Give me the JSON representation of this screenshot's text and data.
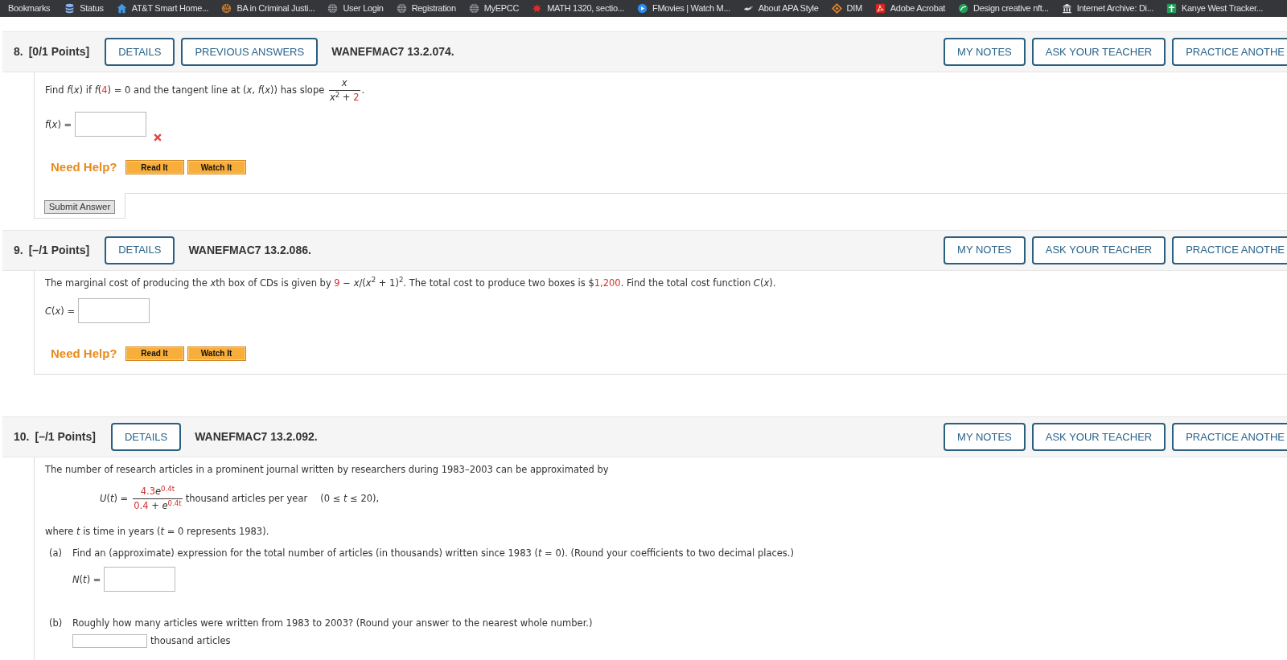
{
  "bookmarks_bar": {
    "label": "Bookmarks",
    "items": [
      {
        "label": "Status"
      },
      {
        "label": "AT&T Smart Home..."
      },
      {
        "label": "BA in Criminal Justi..."
      },
      {
        "label": "User Login"
      },
      {
        "label": "Registration"
      },
      {
        "label": "MyEPCC"
      },
      {
        "label": "MATH 1320, sectio..."
      },
      {
        "label": "FMovies | Watch M..."
      },
      {
        "label": "About APA Style"
      },
      {
        "label": "DIM"
      },
      {
        "label": "Adobe Acrobat"
      },
      {
        "label": "Design creative nft..."
      },
      {
        "label": "Internet Archive: Di..."
      },
      {
        "label": "Kanye West Tracker..."
      }
    ]
  },
  "questions": [
    {
      "number": "8.",
      "points": "[0/1 Points]",
      "header_buttons": [
        "DETAILS",
        "PREVIOUS ANSWERS"
      ],
      "code": "WANEFMAC7 13.2.074.",
      "side_buttons": [
        "MY NOTES",
        "ASK YOUR TEACHER",
        "PRACTICE ANOTHE"
      ],
      "blocks": [
        {
          "kind": "paragraph",
          "segments": [
            {
              "kind": "plain",
              "text": "Find *f*(*x*) if *f*("
            },
            {
              "kind": "given",
              "text": "4"
            },
            {
              "kind": "plain",
              "text": ") = 0 and the tangent line at (*x*, *f*(*x*)) has slope "
            },
            {
              "kind": "fraction",
              "numerator": [
                {
                  "kind": "plain",
                  "text": "*x*"
                }
              ],
              "denominator": [
                {
                  "kind": "plain",
                  "text": "*x*$^{2}$ + "
                },
                {
                  "kind": "given",
                  "text": "2"
                }
              ]
            },
            {
              "kind": "plain",
              "text": "."
            }
          ]
        },
        {
          "kind": "answer",
          "label": "*f*(*x*) =",
          "correct": false
        }
      ],
      "need_help": {
        "label": "Need Help?",
        "buttons": [
          "Read It",
          "Watch It"
        ]
      },
      "submit_button": "Submit Answer"
    },
    {
      "number": "9.",
      "points": "[–/1 Points]",
      "header_buttons": [
        "DETAILS"
      ],
      "code": "WANEFMAC7 13.2.086.",
      "side_buttons": [
        "MY NOTES",
        "ASK YOUR TEACHER",
        "PRACTICE ANOTHE"
      ],
      "blocks": [
        {
          "kind": "paragraph",
          "segments": [
            {
              "kind": "plain",
              "text": "The marginal cost of producing the "
            },
            {
              "kind": "plain",
              "text": "*x*"
            },
            {
              "kind": "plain",
              "text": "th box of CDs is given by "
            },
            {
              "kind": "given",
              "text": "9"
            },
            {
              "kind": "plain",
              "text": " − *x*/(*x*$^{2}$ + 1)$^{2}$. The total cost to produce two boxes is $"
            },
            {
              "kind": "given",
              "text": "1,200"
            },
            {
              "kind": "plain",
              "text": ". Find the total cost function *C*(*x*)."
            }
          ]
        },
        {
          "kind": "answer",
          "label": "*C*(*x*) ="
        }
      ],
      "need_help": {
        "label": "Need Help?",
        "buttons": [
          "Read It",
          "Watch It"
        ]
      }
    },
    {
      "number": "10.",
      "points": "[–/1 Points]",
      "header_buttons": [
        "DETAILS"
      ],
      "code": "WANEFMAC7 13.2.092.",
      "side_buttons": [
        "MY NOTES",
        "ASK YOUR TEACHER",
        "PRACTICE ANOTHE"
      ],
      "blocks": [
        {
          "kind": "paragraph",
          "segments": [
            {
              "kind": "plain",
              "text": "The number of research articles in a prominent journal written by researchers during 1983–2003 can be approximated by"
            }
          ]
        },
        {
          "kind": "formula",
          "label": "*U*(*t*) =",
          "segments": [
            {
              "kind": "fraction",
              "numerator": [
                {
                  "kind": "given",
                  "text": "4.3"
                },
                {
                  "kind": "plain",
                  "text": "*e*"
                },
                {
                  "kind": "given",
                  "text": "$^{0.4t}$"
                }
              ],
              "denominator": [
                {
                  "kind": "given",
                  "text": "0.4"
                },
                {
                  "kind": "plain",
                  "text": " + *e*"
                },
                {
                  "kind": "given",
                  "text": "$^{0.4t}$"
                }
              ]
            }
          ],
          "unit": "thousand articles per year",
          "domain": "(0 ≤ *t* ≤ 20),"
        },
        {
          "kind": "paragraph",
          "segments": [
            {
              "kind": "plain",
              "text": "where *t* is time in years (*t* = 0 represents 1983)."
            }
          ]
        },
        {
          "kind": "part",
          "label": "(a)",
          "segments": [
            {
              "kind": "plain",
              "text": "Find an (approximate) expression for the total number of articles (in thousands) written since 1983 (*t* = 0). (Round your coefficients to two decimal places.)"
            }
          ],
          "children": [
            {
              "kind": "answer",
              "label": "*N*(*t*) ="
            }
          ]
        },
        {
          "kind": "part",
          "label": "(b)",
          "segments": [
            {
              "kind": "plain",
              "text": "Roughly how many articles were written from 1983 to 2003? (Round your answer to the nearest whole number.)"
            }
          ],
          "children": [
            {
              "kind": "answer",
              "suffix": "thousand articles"
            }
          ]
        }
      ]
    }
  ]
}
